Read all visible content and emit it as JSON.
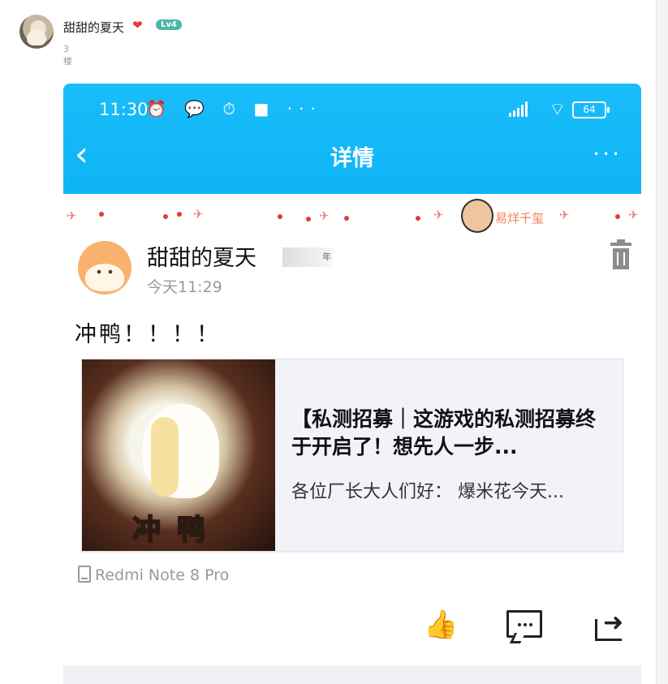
{
  "post": {
    "username": "甜甜的夏天",
    "level": "Lv4",
    "floor": "3楼"
  },
  "screenshot": {
    "statusbar": {
      "time": "11:30",
      "icons_text": "⏰ 💬 ⏱ ■ ···",
      "battery": "64"
    },
    "nav": {
      "back": "‹",
      "title": "详情",
      "more": "···"
    },
    "decoration": {
      "signature": "易烊千玺"
    },
    "author": {
      "name": "甜甜的夏天",
      "badge": "年",
      "time": "今天11:29"
    },
    "content": "冲鸭！！！！",
    "card": {
      "image_caption": "冲 鸭",
      "title": "【私测招募｜这游戏的私测招募终于开启了！想先人一步...",
      "subtitle": "各位厂长大人们好： 爆米花今天..."
    },
    "device": "Redmi Note 8 Pro"
  }
}
